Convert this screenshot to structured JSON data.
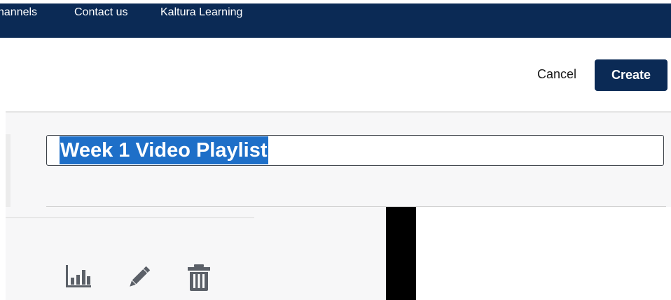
{
  "nav": {
    "items": [
      {
        "label": "hannels"
      },
      {
        "label": "Contact us"
      },
      {
        "label": "Kaltura Learning"
      }
    ]
  },
  "header": {
    "cancel_label": "Cancel",
    "create_label": "Create"
  },
  "title_field": {
    "value": "Week 1 Video Playlist",
    "selected": true
  },
  "actions": {
    "icons": [
      "bar-chart-icon",
      "pencil-icon",
      "trash-icon"
    ]
  },
  "colors": {
    "navbar": "#0b2a55",
    "create_button": "#0b2a55",
    "selection": "#1e6fc8",
    "icon": "#5b6068"
  }
}
